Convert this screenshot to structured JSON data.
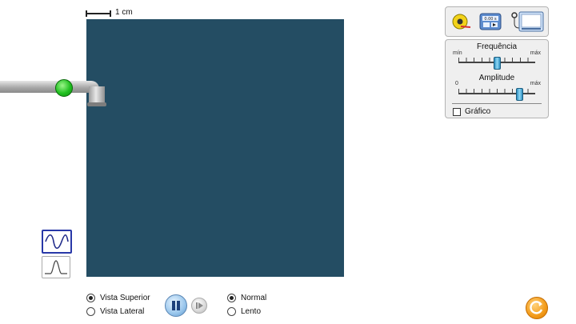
{
  "scale": {
    "label": "1 cm"
  },
  "controls": {
    "frequency": {
      "label": "Frequência",
      "min_label": "mín",
      "max_label": "máx",
      "value_fraction": 0.5
    },
    "amplitude": {
      "label": "Amplitude",
      "min_label": "0",
      "max_label": "máx",
      "value_fraction": 0.8
    },
    "graph_checkbox": {
      "label": "Gráfico",
      "checked": false
    }
  },
  "view": {
    "options": [
      "Vista Superior",
      "Vista Lateral"
    ],
    "selected": "Vista Superior"
  },
  "speed": {
    "options": [
      "Normal",
      "Lento"
    ],
    "selected": "Normal"
  },
  "timer_display": "0.00 s",
  "colors": {
    "water": "#244d63",
    "faucet_button": "#22c022",
    "slider_thumb": "#4fb0e0",
    "reset_button": "#f39b1a"
  },
  "icons": {
    "tools": [
      "measuring-tape-icon",
      "stopwatch-icon",
      "wave-probe-icon"
    ],
    "wave_modes": [
      "sine-wave-icon",
      "pulse-wave-icon"
    ],
    "playback": [
      "pause-icon",
      "step-icon"
    ],
    "reset": "reset-icon"
  }
}
